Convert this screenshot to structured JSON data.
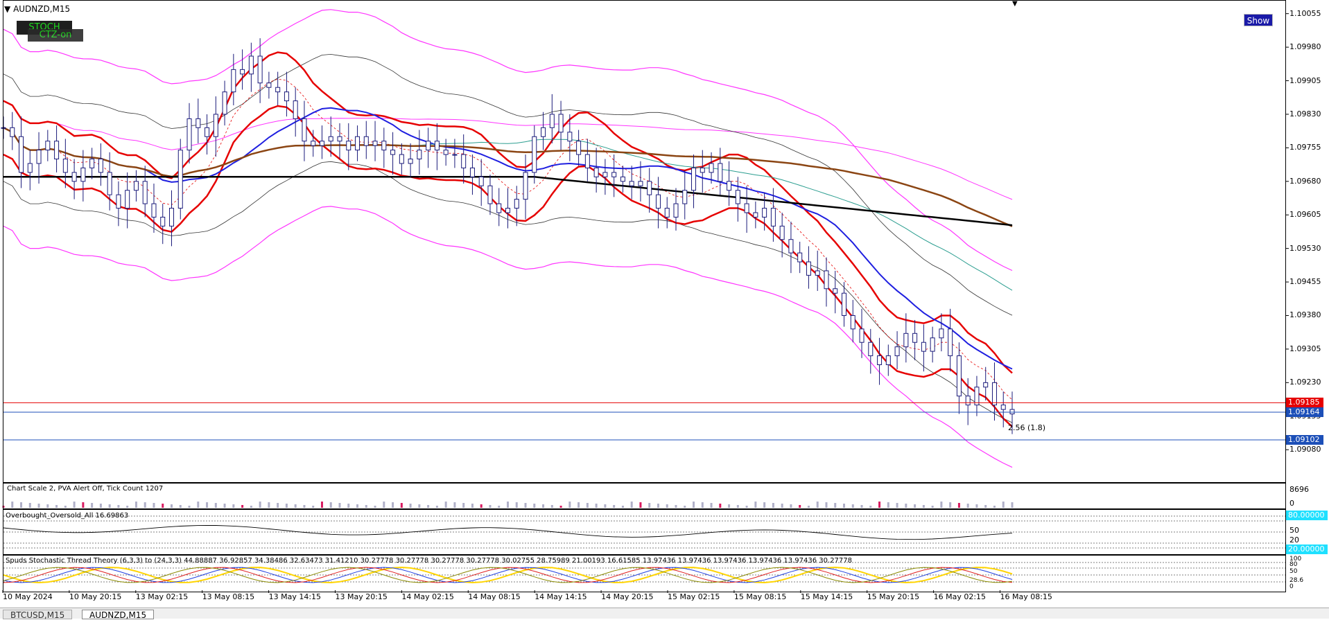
{
  "symbol_title": "AUDNZD,M15",
  "show_button": "Show",
  "stoch_button": "STOCH",
  "ctz_button": "CTZ-on",
  "chart_data": {
    "type": "candlestick",
    "symbol": "AUDNZD",
    "timeframe": "M15",
    "y_ticks": [
      "1.10055",
      "1.09980",
      "1.09905",
      "1.09830",
      "1.09755",
      "1.09680",
      "1.09605",
      "1.09530",
      "1.09455",
      "1.09380",
      "1.09305",
      "1.09230",
      "1.09155",
      "1.09080"
    ],
    "ylim": [
      1.0904,
      1.1007
    ],
    "x_ticks": [
      "10 May 2024",
      "10 May 20:15",
      "13 May 02:15",
      "13 May 08:15",
      "13 May 14:15",
      "13 May 20:15",
      "14 May 02:15",
      "14 May 08:15",
      "14 May 14:15",
      "14 May 20:15",
      "15 May 02:15",
      "15 May 08:15",
      "15 May 14:15",
      "15 May 20:15",
      "16 May 02:15",
      "16 May 08:15"
    ],
    "price_lines": [
      {
        "value": "1.09185",
        "color": "#e60000",
        "label_bg": "#e60000"
      },
      {
        "value": "1.09164",
        "color": "#1c4fb8",
        "label_bg": "#1c4fb8"
      },
      {
        "value": "1.09102",
        "color": "#1c4fb8",
        "label_bg": "#1c4fb8"
      }
    ],
    "price_annotation": "2.56 (1.8)",
    "close_series": [
      1.098,
      1.0978,
      1.097,
      1.0972,
      1.0975,
      1.0977,
      1.0973,
      1.097,
      1.0968,
      1.0971,
      1.0973,
      1.097,
      1.0965,
      1.0962,
      1.0966,
      1.0968,
      1.0963,
      1.096,
      1.0958,
      1.0962,
      1.0975,
      1.0982,
      1.098,
      1.0978,
      1.0983,
      1.0988,
      1.0993,
      1.0992,
      1.0996,
      1.099,
      1.0989,
      1.0988,
      1.0986,
      1.0982,
      1.0977,
      1.0976,
      1.0977,
      1.0978,
      1.0977,
      1.0975,
      1.0978,
      1.0976,
      1.0977,
      1.0975,
      1.0974,
      1.0972,
      1.0973,
      1.0975,
      1.0977,
      1.0975,
      1.0974,
      1.0974,
      1.0971,
      1.0969,
      1.0967,
      1.0963,
      1.0961,
      1.0962,
      1.0964,
      1.097,
      1.0978,
      1.098,
      1.0983,
      1.0979,
      1.0977,
      1.0974,
      1.0971,
      1.0969,
      1.097,
      1.0969,
      1.0968,
      1.0967,
      1.0968,
      1.0965,
      1.0962,
      1.096,
      1.0963,
      1.0966,
      1.0971,
      1.097,
      1.0972,
      1.0968,
      1.0966,
      1.0963,
      1.0961,
      1.096,
      1.0962,
      1.0958,
      1.0955,
      1.0952,
      1.095,
      1.0947,
      1.0948,
      1.0944,
      1.0943,
      1.0938,
      1.0935,
      1.0932,
      1.0929,
      1.0927,
      1.0929,
      1.0931,
      1.0934,
      1.0932,
      1.093,
      1.0933,
      1.0935,
      1.0929,
      1.092,
      1.0918,
      1.0922,
      1.0923,
      1.0918,
      1.0917,
      1.0916
    ],
    "volume_panel": {
      "label": "Chart Scale  2,   PVA Alert Off,   Tick Count  1207",
      "ymax": "8696",
      "ymin": "0"
    },
    "oscillator_panel": {
      "label": "Overbought_Oversold_All 16.69863",
      "levels": [
        "50",
        "20"
      ],
      "tags": [
        "80.00000",
        "20.00000"
      ]
    },
    "stoch_panel": {
      "label": "Spuds Stochastic Thread Theory (6,3,3) to (24,3,3) 44.88887 36.92857 34.38486 32.63473 31.41210 30.27778 30.27778 30.27778 30.27778 30.02755 28.75989 21.00193 16.61585 13.97436 13.97436 13.97436 13.97436 13.97436 30.27778",
      "levels": [
        "100",
        "80",
        "50",
        "20",
        "0"
      ],
      "right_label": "28.6"
    }
  },
  "tabs": [
    {
      "label": "BTCUSD,M15",
      "active": false
    },
    {
      "label": "AUDNZD,M15",
      "active": true
    }
  ],
  "colors": {
    "bull": "#1a1a7a",
    "bear": "#1a1a7a",
    "band_outer": "#ff33ff",
    "ma_red": "#e60000",
    "ma_blue": "#1f1fe0",
    "ma_brown": "#8b4513",
    "ma_black": "#000000"
  }
}
